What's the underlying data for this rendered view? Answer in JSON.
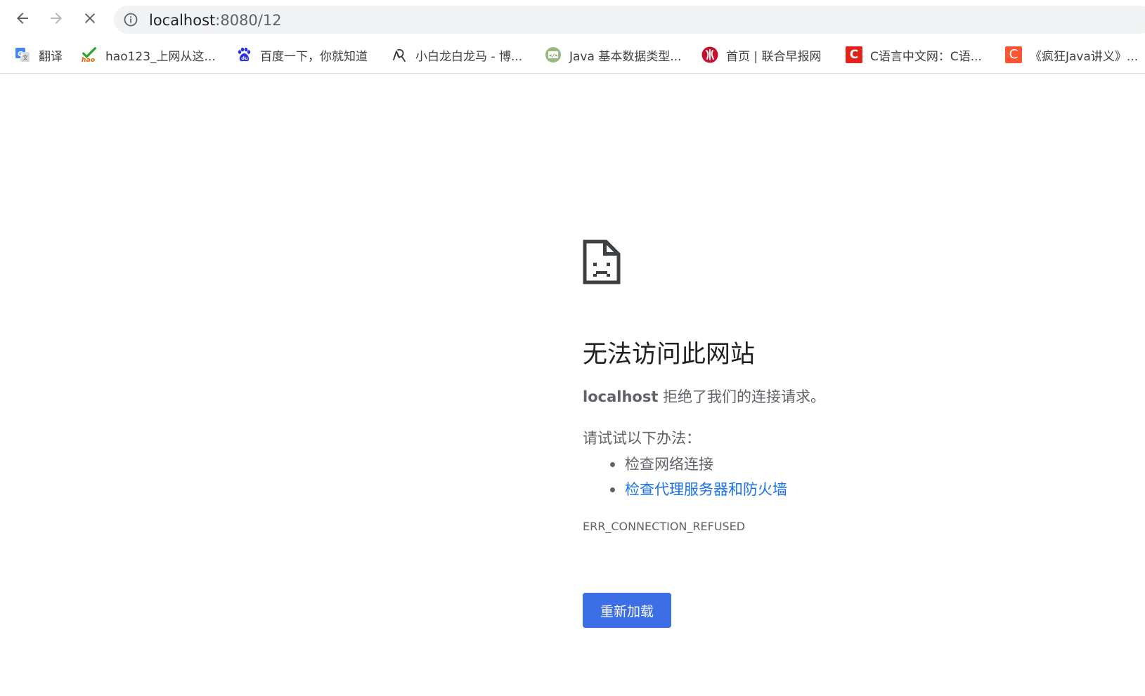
{
  "toolbar": {
    "back_icon": "arrow-left-icon",
    "forward_icon": "arrow-right-icon",
    "stop_icon": "close-icon",
    "site_info_icon": "info-icon",
    "url_host": "localhost",
    "url_rest": ":8080/12"
  },
  "bookmarks": [
    {
      "label": "翻译",
      "icon": "google-translate-icon"
    },
    {
      "label": "hao123_上网从这...",
      "icon": "hao123-icon"
    },
    {
      "label": "百度一下，你就知道",
      "icon": "baidu-paw-icon"
    },
    {
      "label": "小白龙白龙马 - 博...",
      "icon": "blog-icon"
    },
    {
      "label": "Java 基本数据类型...",
      "icon": "runoob-icon"
    },
    {
      "label": "首页 | 联合早报网",
      "icon": "zaobao-icon"
    },
    {
      "label": "C语言中文网：C语...",
      "icon": "c-biancheng-icon",
      "icon_letter": "C"
    },
    {
      "label": "《疯狂Java讲义》...",
      "icon": "csdn-icon",
      "icon_letter": "C"
    }
  ],
  "error": {
    "icon": "sad-document-icon",
    "title": "无法访问此网站",
    "host": "localhost",
    "message": " 拒绝了我们的连接请求。",
    "suggestions_title": "请试试以下办法：",
    "suggestions": [
      "检查网络连接",
      "检查代理服务器和防火墙"
    ],
    "code": "ERR_CONNECTION_REFUSED",
    "reload_label": "重新加载"
  },
  "colors": {
    "link": "#1a73e8",
    "button": "#3c6ee6",
    "text_secondary": "#5f6368"
  }
}
